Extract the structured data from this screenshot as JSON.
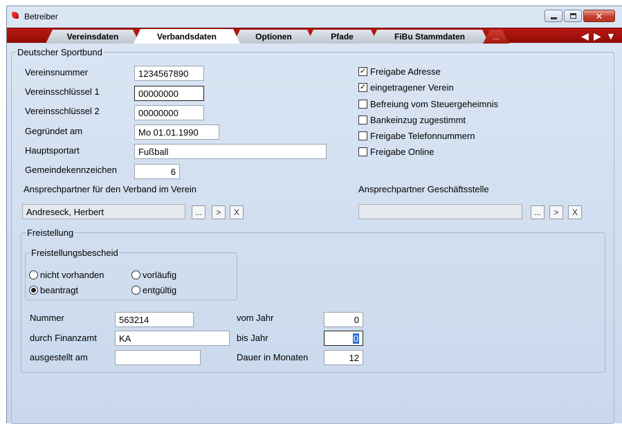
{
  "window": {
    "title": "Betreiber"
  },
  "tabs": [
    {
      "label": "Vereinsdaten"
    },
    {
      "label": "Verbandsdaten"
    },
    {
      "label": "Optionen"
    },
    {
      "label": "Pfade"
    },
    {
      "label": "FiBu Stammdaten"
    },
    {
      "label": "..."
    }
  ],
  "nav": {
    "left": "◀",
    "right": "▶",
    "down": "▼"
  },
  "dsb": {
    "legend": "Deutscher Sportbund",
    "vereinsnummer": {
      "label": "Vereinsnummer",
      "value": "1234567890"
    },
    "schluessel1": {
      "label": "Vereinsschlüssel 1",
      "value": "00000000"
    },
    "schluessel2": {
      "label": "Vereinsschlüssel 2",
      "value": "00000000"
    },
    "gegruendet": {
      "label": "Gegründet am",
      "value": "Mo 01.01.1990"
    },
    "hauptsportart": {
      "label": "Hauptsportart",
      "value": "Fußball"
    },
    "gemeinde": {
      "label": "Gemeindekennzeichen",
      "value": "6"
    },
    "checkboxes": [
      {
        "label": "Freigabe Adresse",
        "checked": true,
        "mark": "✓"
      },
      {
        "label": "eingetragener Verein",
        "checked": true,
        "mark": "✓"
      },
      {
        "label": "Befreiung vom Steuergeheimnis",
        "checked": false,
        "mark": ""
      },
      {
        "label": "Bankeinzug zugestimmt",
        "checked": false,
        "mark": ""
      },
      {
        "label": "Freigabe Telefonnummern",
        "checked": false,
        "mark": ""
      },
      {
        "label": "Freigabe Online",
        "checked": false,
        "mark": ""
      }
    ],
    "contact_verein": {
      "label": "Ansprechpartner für den Verband  im Verein",
      "value": "Andreseck, Herbert"
    },
    "contact_gs": {
      "label": "Ansprechpartner  Geschäftsstelle",
      "value": ""
    },
    "btn_browse": "...",
    "btn_go": ">",
    "btn_clear": "X"
  },
  "freistellung": {
    "legend": "Freistellung",
    "bescheid_legend": "Freistellungsbescheid",
    "radios": [
      {
        "label": "nicht vorhanden",
        "selected": false
      },
      {
        "label": "vorläufig",
        "selected": false
      },
      {
        "label": "beantragt",
        "selected": true
      },
      {
        "label": "entgültig",
        "selected": false
      }
    ],
    "nummer": {
      "label": "Nummer",
      "value": "563214"
    },
    "finanzamt": {
      "label": "durch Finanzamt",
      "value": "KA"
    },
    "ausgestellt": {
      "label": "ausgestellt am",
      "value": ""
    },
    "vom_jahr": {
      "label": "vom Jahr",
      "value": "0"
    },
    "bis_jahr": {
      "label": "bis Jahr",
      "value": "0"
    },
    "dauer": {
      "label": "Dauer in Monaten",
      "value": "12"
    }
  }
}
